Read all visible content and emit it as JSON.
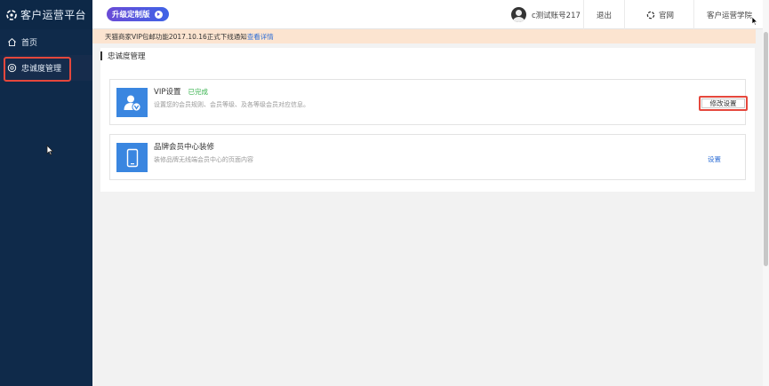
{
  "brand": {
    "name": "客户运营平台"
  },
  "sidebar": {
    "items": [
      {
        "label": "首页",
        "icon": "home-icon"
      },
      {
        "label": "忠诚度管理",
        "icon": "loyalty-icon"
      }
    ]
  },
  "topbar": {
    "upgrade_label": "升级定制版",
    "account_name": "c测试账号217",
    "logout_label": "退出",
    "official_label": "官网",
    "academy_label": "客户运营学院"
  },
  "notice": {
    "text": "天猫商家VIP包邮功能2017.10.16正式下线通知",
    "link": "查看详情"
  },
  "section": {
    "title": "忠诚度管理"
  },
  "cards": [
    {
      "title": "VIP设置",
      "status": "已完成",
      "desc": "设置您的会员规则、会员等级、及各等级会员对应信息。",
      "action": "修改设置"
    },
    {
      "title": "品牌会员中心装修",
      "desc": "装修品牌无线端会员中心的页面内容",
      "action": "设置"
    }
  ],
  "colors": {
    "sidebar_bg": "#0f2a4a",
    "accent_blue": "#3a86e0",
    "status_green": "#37b24d",
    "highlight_red": "#e5473c",
    "notice_bg": "#fce4d0"
  }
}
